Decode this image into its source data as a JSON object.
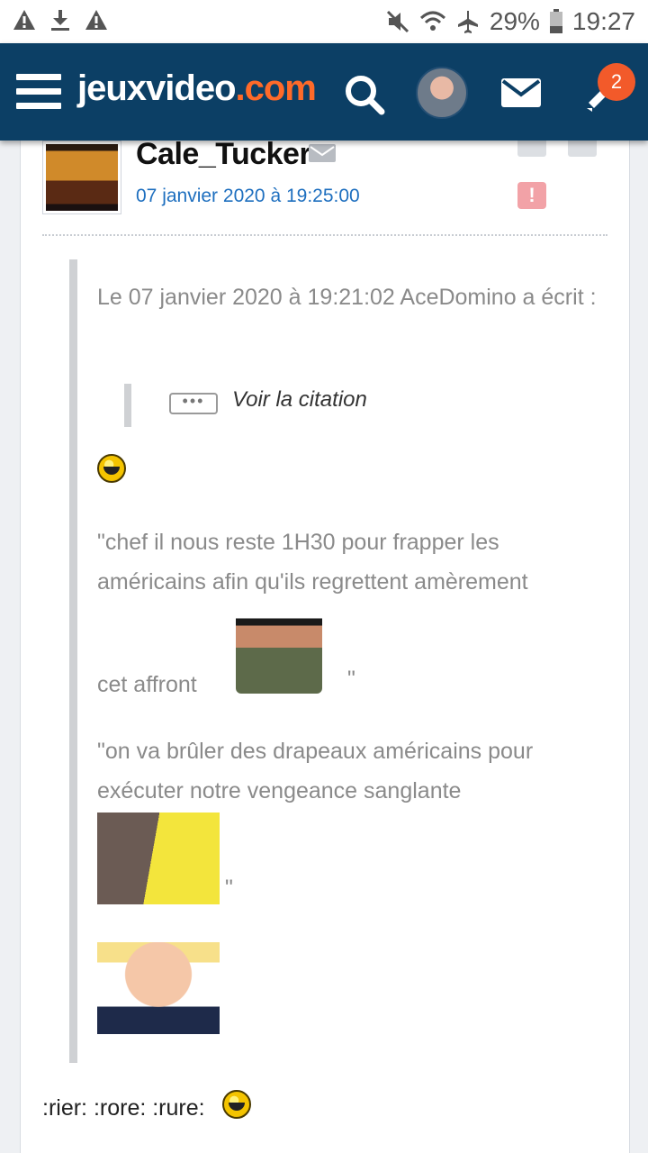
{
  "status_bar": {
    "battery": "29%",
    "time": "19:27",
    "icons": [
      "warning-icon",
      "download-icon",
      "warning-icon",
      "mute-icon",
      "wifi-icon",
      "airplane-icon",
      "battery-icon"
    ]
  },
  "header": {
    "logo_main": "jeuxvideo",
    "logo_com": ".com",
    "notification_count": "2",
    "brand_color": "#0c3f65",
    "accent_color": "#ff6a29"
  },
  "post": {
    "author": "Cale_Tucker",
    "date": "07 janvier 2020 à 19:25:00",
    "alert_label": "!",
    "quote": {
      "intro": "Le 07 janvier 2020 à 19:21:02 AceDomino a écrit :",
      "nested_button": "•••",
      "nested_label": "Voir la citation",
      "line1": "\"chef il nous reste 1H30 pour frapper les américains afin qu'ils regrettent amèrement",
      "line1_end": "cet affront",
      "line1_close": "\"",
      "line2": "\"on va brûler des drapeaux américains pour exécuter notre vengeance sanglante",
      "line2_close": "\""
    },
    "footer_text": ":rier: :rore: :rure:"
  }
}
